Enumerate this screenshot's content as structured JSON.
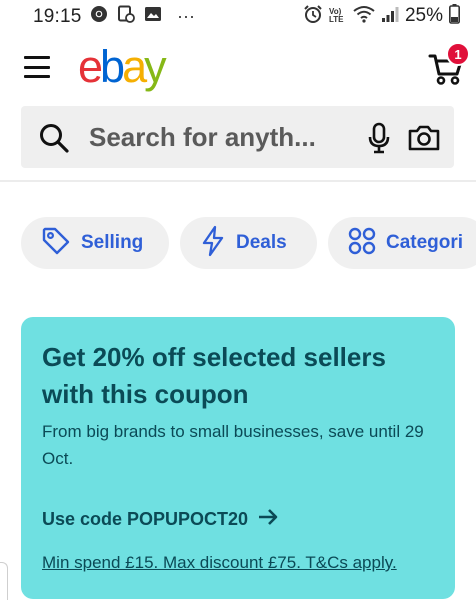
{
  "status_bar": {
    "time": "19:15",
    "left_icons": [
      "chrome-icon",
      "android-auto-icon",
      "image-icon",
      "more-icon"
    ],
    "overflow": "···",
    "right_icons": [
      "alarm-icon",
      "volte-icon",
      "wifi-icon",
      "signal-icon",
      "battery-icon"
    ],
    "volte_label": "Vo)\nLTE",
    "battery": "25%"
  },
  "header": {
    "logo": {
      "e": "e",
      "b": "b",
      "a": "a",
      "y": "y"
    },
    "cart_count": "1"
  },
  "search": {
    "placeholder": "Search for anyth..."
  },
  "chips": [
    {
      "label": "Selling",
      "icon": "tag-icon"
    },
    {
      "label": "Deals",
      "icon": "lightning-icon"
    },
    {
      "label": "Categori",
      "icon": "grid-icon"
    }
  ],
  "promo": {
    "title": "Get 20% off selected sellers with this coupon",
    "subtitle": "From big brands to small businesses, save until 29 Oct.",
    "code_text": "Use code POPUPOCT20",
    "terms": "Min spend £15. Max discount £75. T&Cs apply."
  },
  "colors": {
    "accent_blue": "#2f5fd7",
    "promo_bg": "#6fe0e1",
    "promo_text": "#0b4a56",
    "badge_red": "#e0103a"
  }
}
